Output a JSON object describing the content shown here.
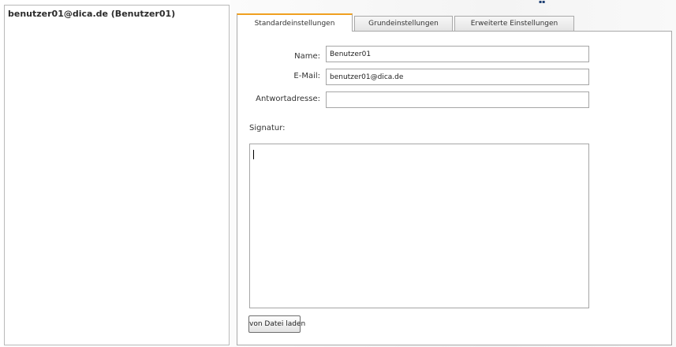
{
  "accounts": {
    "items": [
      {
        "label": "benutzer01@dica.de (Benutzer01)"
      }
    ]
  },
  "tabs": [
    {
      "label": "Standardeinstellungen",
      "active": true
    },
    {
      "label": "Grundeinstellungen",
      "active": false
    },
    {
      "label": "Erweiterte Einstellungen",
      "active": false
    }
  ],
  "form": {
    "name_label": "Name:",
    "name_value": "Benutzer01",
    "email_label": "E-Mail:",
    "email_value": "benutzer01@dica.de",
    "reply_label": "Antwortadresse:",
    "reply_value": "",
    "signature_label": "Signatur:",
    "signature_value": "",
    "load_button_label": "von Datei laden"
  },
  "colors": {
    "active_tab_accent": "#f0a020",
    "border": "#a6a6a6"
  }
}
